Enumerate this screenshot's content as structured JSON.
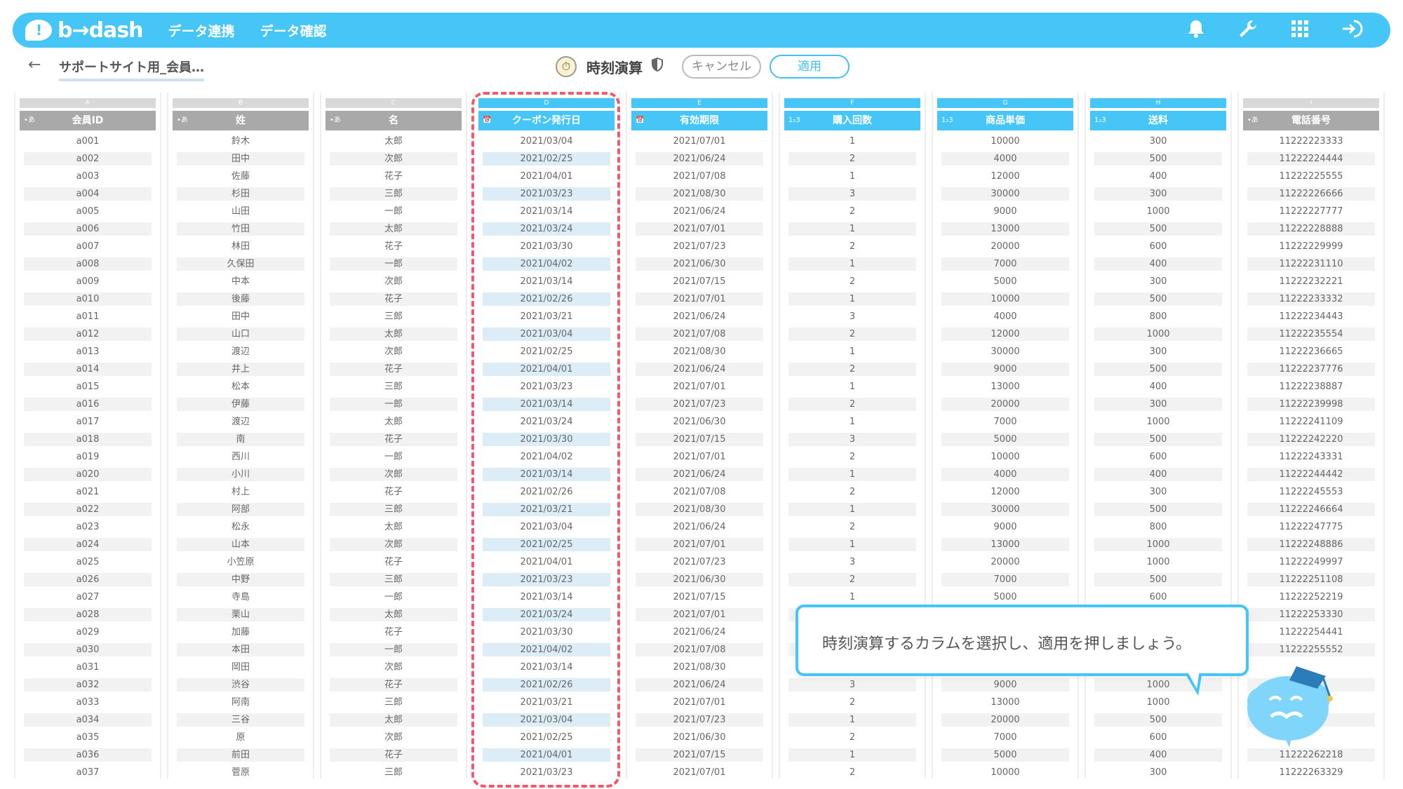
{
  "navbar": {
    "logo_mark": "!",
    "logo_text": "b→dash",
    "links": [
      "データ連携",
      "データ確認"
    ],
    "icons": [
      "bell-icon",
      "wrench-icon",
      "grid-icon",
      "logout-icon"
    ]
  },
  "subheader": {
    "back": "←",
    "breadcrumb": "サポートサイト用_会員…",
    "operation_title": "時刻演算",
    "cancel_label": "キャンセル",
    "apply_label": "適用"
  },
  "tooltip": {
    "text": "時刻演算するカラムを選択し、適用を押しましょう。"
  },
  "colors": {
    "accent": "#46c6f7",
    "selection": "#ef5b6c",
    "header_gray": "#a9a9a9"
  },
  "table": {
    "columns": [
      {
        "letter": "A",
        "name": "会員ID",
        "type_icon": "•あ",
        "blue": false,
        "selected": false,
        "values": [
          "a001",
          "a002",
          "a003",
          "a004",
          "a005",
          "a006",
          "a007",
          "a008",
          "a009",
          "a010",
          "a011",
          "a012",
          "a013",
          "a014",
          "a015",
          "a016",
          "a017",
          "a018",
          "a019",
          "a020",
          "a021",
          "a022",
          "a023",
          "a024",
          "a025",
          "a026",
          "a027",
          "a028",
          "a029",
          "a030",
          "a031",
          "a032",
          "a033",
          "a034",
          "a035",
          "a036",
          "a037"
        ]
      },
      {
        "letter": "B",
        "name": "姓",
        "type_icon": "•あ",
        "blue": false,
        "selected": false,
        "values": [
          "鈴木",
          "田中",
          "佐藤",
          "杉田",
          "山田",
          "竹田",
          "林田",
          "久保田",
          "中本",
          "後藤",
          "田中",
          "山口",
          "渡辺",
          "井上",
          "松本",
          "伊藤",
          "渡辺",
          "南",
          "西川",
          "小川",
          "村上",
          "阿部",
          "松永",
          "山本",
          "小笠原",
          "中野",
          "寺島",
          "栗山",
          "加藤",
          "本田",
          "岡田",
          "渋谷",
          "阿南",
          "三谷",
          "原",
          "前田",
          "菅原"
        ]
      },
      {
        "letter": "C",
        "name": "名",
        "type_icon": "•あ",
        "blue": false,
        "selected": false,
        "values": [
          "太郎",
          "次郎",
          "花子",
          "三郎",
          "一郎",
          "太郎",
          "花子",
          "一郎",
          "次郎",
          "花子",
          "三郎",
          "太郎",
          "次郎",
          "花子",
          "三郎",
          "一郎",
          "太郎",
          "花子",
          "一郎",
          "次郎",
          "花子",
          "三郎",
          "太郎",
          "次郎",
          "花子",
          "三郎",
          "一郎",
          "太郎",
          "花子",
          "一郎",
          "次郎",
          "花子",
          "三郎",
          "太郎",
          "次郎",
          "花子",
          "三郎"
        ]
      },
      {
        "letter": "D",
        "name": "クーポン発行日",
        "type_icon": "📅",
        "blue": true,
        "selected": true,
        "values": [
          "2021/03/04",
          "2021/02/25",
          "2021/04/01",
          "2021/03/23",
          "2021/03/14",
          "2021/03/24",
          "2021/03/30",
          "2021/04/02",
          "2021/03/14",
          "2021/02/26",
          "2021/03/21",
          "2021/03/04",
          "2021/02/25",
          "2021/04/01",
          "2021/03/23",
          "2021/03/14",
          "2021/03/24",
          "2021/03/30",
          "2021/04/02",
          "2021/03/14",
          "2021/02/26",
          "2021/03/21",
          "2021/03/04",
          "2021/02/25",
          "2021/04/01",
          "2021/03/23",
          "2021/03/14",
          "2021/03/24",
          "2021/03/30",
          "2021/04/02",
          "2021/03/14",
          "2021/02/26",
          "2021/03/21",
          "2021/03/04",
          "2021/02/25",
          "2021/04/01",
          "2021/03/23"
        ]
      },
      {
        "letter": "E",
        "name": "有効期限",
        "type_icon": "📅",
        "blue": true,
        "selected": false,
        "values": [
          "2021/07/01",
          "2021/06/24",
          "2021/07/08",
          "2021/08/30",
          "2021/06/24",
          "2021/07/01",
          "2021/07/23",
          "2021/06/30",
          "2021/07/15",
          "2021/07/01",
          "2021/06/24",
          "2021/07/08",
          "2021/08/30",
          "2021/06/24",
          "2021/07/01",
          "2021/07/23",
          "2021/06/30",
          "2021/07/15",
          "2021/07/01",
          "2021/06/24",
          "2021/07/08",
          "2021/08/30",
          "2021/06/24",
          "2021/07/01",
          "2021/07/23",
          "2021/06/30",
          "2021/07/15",
          "2021/07/01",
          "2021/06/24",
          "2021/07/08",
          "2021/08/30",
          "2021/06/24",
          "2021/07/01",
          "2021/07/23",
          "2021/06/30",
          "2021/07/15",
          "2021/07/01"
        ]
      },
      {
        "letter": "F",
        "name": "購入回数",
        "type_icon": "1₂3",
        "blue": true,
        "selected": false,
        "values": [
          "1",
          "2",
          "1",
          "3",
          "2",
          "1",
          "2",
          "1",
          "2",
          "1",
          "3",
          "2",
          "1",
          "2",
          "1",
          "2",
          "1",
          "3",
          "2",
          "1",
          "2",
          "1",
          "2",
          "1",
          "3",
          "2",
          "1",
          "",
          "",
          "",
          "",
          "3",
          "2",
          "1",
          "2",
          "1",
          "2"
        ]
      },
      {
        "letter": "G",
        "name": "商品単価",
        "type_icon": "1₂3",
        "blue": true,
        "selected": false,
        "values": [
          "10000",
          "4000",
          "12000",
          "30000",
          "9000",
          "13000",
          "20000",
          "7000",
          "5000",
          "10000",
          "4000",
          "12000",
          "30000",
          "9000",
          "13000",
          "20000",
          "7000",
          "5000",
          "10000",
          "4000",
          "12000",
          "30000",
          "9000",
          "13000",
          "20000",
          "7000",
          "5000",
          "",
          "",
          "",
          "",
          "9000",
          "13000",
          "20000",
          "7000",
          "5000",
          "10000"
        ]
      },
      {
        "letter": "H",
        "name": "送料",
        "type_icon": "1₂3",
        "blue": true,
        "selected": false,
        "values": [
          "300",
          "500",
          "400",
          "300",
          "1000",
          "500",
          "600",
          "400",
          "300",
          "500",
          "800",
          "1000",
          "300",
          "500",
          "400",
          "300",
          "1000",
          "500",
          "600",
          "400",
          "300",
          "500",
          "800",
          "1000",
          "1000",
          "500",
          "600",
          "",
          "",
          "",
          "",
          "1000",
          "1000",
          "500",
          "600",
          "400",
          "300"
        ]
      },
      {
        "letter": "I",
        "name": "電話番号",
        "type_icon": "•あ",
        "blue": false,
        "selected": false,
        "values": [
          "11222223333",
          "11222224444",
          "11222225555",
          "11222226666",
          "11222227777",
          "11222228888",
          "11222229999",
          "11222231110",
          "11222232221",
          "11222233332",
          "11222234443",
          "11222235554",
          "11222236665",
          "11222237776",
          "11222238887",
          "11222239998",
          "11222241109",
          "11222242220",
          "11222243331",
          "11222244442",
          "11222245553",
          "11222246664",
          "11222247775",
          "11222248886",
          "11222249997",
          "11222251108",
          "11222252219",
          "11222253330",
          "11222254441",
          "11222255552",
          "",
          "",
          "",
          "",
          "",
          "11222262218",
          "11222263329"
        ]
      }
    ]
  }
}
